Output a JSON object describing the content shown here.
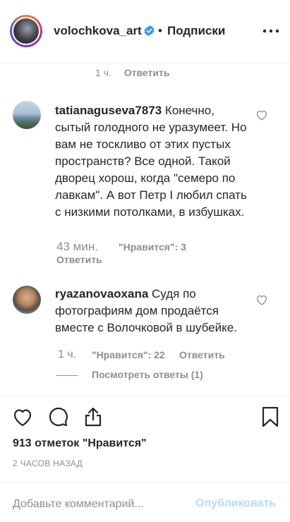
{
  "header": {
    "username": "volochkova_art",
    "separator": "•",
    "follow_label": "Подписки",
    "verified_color": "#3897f0"
  },
  "top_comment_meta": {
    "time": "1 ч.",
    "reply_label": "Ответить"
  },
  "comments": [
    {
      "username": "tatianaguseva7873",
      "text": " Конечно, сытый голодного не уразумеет. Но вам не тоскливо от этих пустых пространств? Все одной. Такой дворец хорош, когда \"семеро по лавкам\". А вот Петр I любил спать с низкими потолками, в избушках.",
      "time": "43 мин.",
      "likes": "\"Нравится\": 3",
      "reply_label": "Ответить"
    },
    {
      "username": "ryazanovaoxana",
      "text": " Судя по фотографиям дом продаётся вместе с Волочковой в шубейке.",
      "time": "1 ч.",
      "likes": "\"Нравится\": 22",
      "reply_label": "Ответить",
      "view_replies": "Посмотреть ответы (1)"
    }
  ],
  "post": {
    "likes_count": "913 отметок \"Нравится\"",
    "timestamp": "2 ЧАСОВ НАЗАД"
  },
  "comment_box": {
    "placeholder": "Добавьте комментарий...",
    "publish_label": "Опубликовать",
    "publish_color": "#b3dbff"
  },
  "icons": {
    "more": "more-horizontal-icon",
    "like": "heart-icon",
    "comment": "comment-bubble-icon",
    "share": "share-icon",
    "save": "bookmark-icon"
  }
}
